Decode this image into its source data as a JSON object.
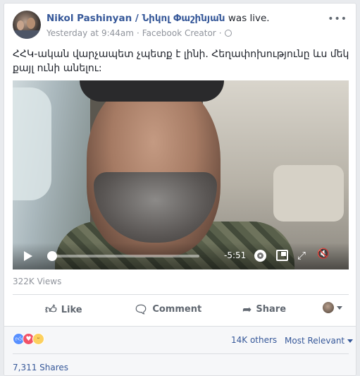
{
  "post": {
    "author": "Nikol Pashinyan / Նիկոլ Փաշինյան",
    "status": "was live.",
    "time": "Yesterday at 9:44am",
    "source": "Facebook Creator",
    "text": "ՀՀԿ-ական վարչապետ չպետք է լինի. Հեղափոխությունը ևս մեկ քայլ ունի անելու:"
  },
  "video": {
    "time_remaining": "-5:51",
    "progress": 0.03
  },
  "stats": {
    "views": "322K Views",
    "reactions_others": "14K others",
    "sort": "Most Relevant",
    "shares": "7,311 Shares"
  },
  "actions": {
    "like": "Like",
    "comment": "Comment",
    "share": "Share"
  },
  "colors": {
    "link": "#365899",
    "muted": "#90949c"
  }
}
